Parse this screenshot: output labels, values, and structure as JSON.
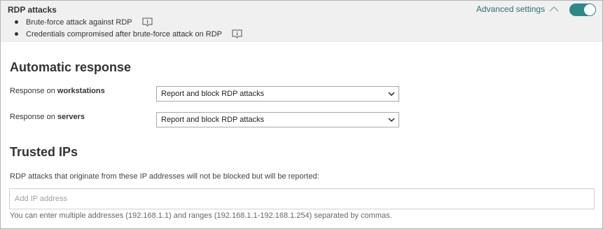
{
  "header": {
    "title": "RDP attacks",
    "bullets": [
      {
        "text": "Brute-force attack against RDP",
        "icon": "info-icon"
      },
      {
        "text": "Credentials compromised after brute-force attack on RDP",
        "icon": "info-icon"
      }
    ],
    "advanced_settings_label": "Advanced settings",
    "toggle_state": "on",
    "toggle_color": "#2a8a87"
  },
  "automatic_response": {
    "heading": "Automatic response",
    "workstations": {
      "label_prefix": "Response on ",
      "label_bold": "workstations",
      "selected": "Report and block RDP attacks"
    },
    "servers": {
      "label_prefix": "Response on ",
      "label_bold": "servers",
      "selected": "Report and block RDP attacks"
    }
  },
  "trusted_ips": {
    "heading": "Trusted IPs",
    "description": "RDP attacks that originate from these IP addresses will not be blocked but will be reported:",
    "input_placeholder": "Add IP address",
    "input_value": "",
    "hint": "You can enter multiple addresses (192.168.1.1) and ranges (192.168.1.1-192.168.1.254) separated by commas."
  }
}
